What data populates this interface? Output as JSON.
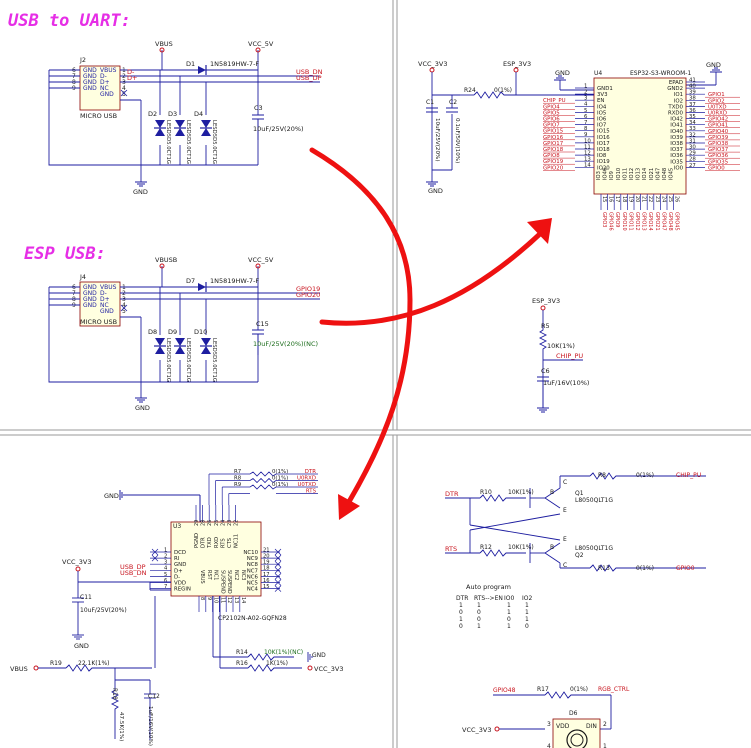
{
  "titles": {
    "usb_uart": "USB to UART:",
    "esp_usb": "ESP USB:"
  },
  "colors": {
    "title": "#e62ee6",
    "wire": "#1e1ea0",
    "net": "#c8141e",
    "part": "#1a1a1a",
    "nc": "#1e6e1e",
    "arrow": "#ee1111",
    "border": "#9a9a9a"
  },
  "usb_uart": {
    "conn_ref": "J2",
    "conn_name": "MICRO USB",
    "pins": [
      {
        "n": "6",
        "name": "GND"
      },
      {
        "n": "7",
        "name": "GND"
      },
      {
        "n": "8",
        "name": "GND"
      },
      {
        "n": "9",
        "name": "GND"
      }
    ],
    "pins_right": [
      {
        "n": "1",
        "name": "VBUS"
      },
      {
        "n": "2",
        "name": "D-"
      },
      {
        "n": "3",
        "name": "D+"
      },
      {
        "n": "4",
        "name": "NC"
      },
      {
        "n": "5",
        "name": "GND"
      }
    ],
    "vbus": "VBUS",
    "vcc": "VCC_5V",
    "diode_ref": "D1",
    "diode_val": "1N5819HW-7-F",
    "nets": [
      "USB_DN",
      "USB_DP"
    ],
    "tvs": [
      {
        "ref": "D2",
        "val": "LESD5D5.0CT1G"
      },
      {
        "ref": "D3",
        "val": "LESD5D5.0CT1G"
      },
      {
        "ref": "D4",
        "val": "LESD5D5.0CT1G"
      }
    ],
    "cap_ref": "C3",
    "cap_val": "10uF/25V(20%)",
    "gnd": "GND",
    "dminus": "D-",
    "dplus": "D+"
  },
  "esp_usb": {
    "conn_ref": "J4",
    "conn_name": "MICRO USB",
    "vbus": "VBUSB",
    "vcc": "VCC_5V",
    "diode_ref": "D7",
    "diode_val": "1N5819HW-7-F",
    "nets": [
      "GPIO19",
      "GPIO20"
    ],
    "tvs": [
      {
        "ref": "D8",
        "val": "LESD5D5.0CT1G"
      },
      {
        "ref": "D9",
        "val": "LESD5D5.0CT1G"
      },
      {
        "ref": "D10",
        "val": "LESD5D5.0CT1G"
      }
    ],
    "cap_ref": "C15",
    "cap_val": "10uF/25V(20%)(NC)",
    "gnd": "GND"
  },
  "esp": {
    "vcc": "VCC_3V3",
    "esp3v3": "ESP_3V3",
    "gnd": "GND",
    "gnd2": "GND",
    "r_ref": "R24",
    "r_val": "0(1%)",
    "c1": {
      "ref": "C1",
      "val": "10uF/25V(20%)"
    },
    "c2": {
      "ref": "C2",
      "val": "0.1uF/50V(10%)"
    },
    "module_ref": "U4",
    "module_name": "ESP32-S3-WROOM-1",
    "left_pins": [
      {
        "n": "1",
        "name": "GND1",
        "net": ""
      },
      {
        "n": "2",
        "name": "3V3",
        "net": ""
      },
      {
        "n": "3",
        "name": "EN",
        "net": "CHIP_PU"
      },
      {
        "n": "4",
        "name": "IO4",
        "net": "GPIO4"
      },
      {
        "n": "5",
        "name": "IO5",
        "net": "GPIO5"
      },
      {
        "n": "6",
        "name": "IO6",
        "net": "GPIO6"
      },
      {
        "n": "7",
        "name": "IO7",
        "net": "GPIO7"
      },
      {
        "n": "8",
        "name": "IO15",
        "net": "GPIO15"
      },
      {
        "n": "9",
        "name": "IO16",
        "net": "GPIO16"
      },
      {
        "n": "10",
        "name": "IO17",
        "net": "GPIO17"
      },
      {
        "n": "11",
        "name": "IO18",
        "net": "GPIO18"
      },
      {
        "n": "12",
        "name": "IO8",
        "net": "GPIO8"
      },
      {
        "n": "13",
        "name": "IO19",
        "net": "GPIO19"
      },
      {
        "n": "14",
        "name": "IO20",
        "net": "GPIO20"
      }
    ],
    "right_pins": [
      {
        "n": "41",
        "name": "EPAD",
        "net": ""
      },
      {
        "n": "40",
        "name": "GND2",
        "net": ""
      },
      {
        "n": "39",
        "name": "IO1",
        "net": "GPIO1"
      },
      {
        "n": "38",
        "name": "IO2",
        "net": "GPIO2"
      },
      {
        "n": "37",
        "name": "TXD0",
        "net": "U0TXD"
      },
      {
        "n": "36",
        "name": "RXD0",
        "net": "U0RXD"
      },
      {
        "n": "35",
        "name": "IO42",
        "net": "GPIO42"
      },
      {
        "n": "34",
        "name": "IO41",
        "net": "GPIO41"
      },
      {
        "n": "33",
        "name": "IO40",
        "net": "GPIO40"
      },
      {
        "n": "32",
        "name": "IO39",
        "net": "GPIO39"
      },
      {
        "n": "31",
        "name": "IO38",
        "net": "GPIO38"
      },
      {
        "n": "30",
        "name": "IO37",
        "net": "GPIO37"
      },
      {
        "n": "29",
        "name": "IO36",
        "net": "GPIO36"
      },
      {
        "n": "28",
        "name": "IO35",
        "net": "GPIO35"
      },
      {
        "n": "27",
        "name": "IO0",
        "net": "GPIO0"
      }
    ],
    "bottom_pins": [
      {
        "n": "15",
        "name": "IO3",
        "net": "GPIO3"
      },
      {
        "n": "16",
        "name": "IO46",
        "net": "GPIO46"
      },
      {
        "n": "17",
        "name": "IO9",
        "net": "GPIO9"
      },
      {
        "n": "18",
        "name": "IO10",
        "net": "GPIO10"
      },
      {
        "n": "19",
        "name": "IO11",
        "net": "GPIO11"
      },
      {
        "n": "20",
        "name": "IO12",
        "net": "GPIO12"
      },
      {
        "n": "21",
        "name": "IO13",
        "net": "GPIO13"
      },
      {
        "n": "22",
        "name": "IO14",
        "net": "GPIO14"
      },
      {
        "n": "23",
        "name": "IO21",
        "net": "GPIO21"
      },
      {
        "n": "24",
        "name": "IO47",
        "net": "GPIO47"
      },
      {
        "n": "25",
        "name": "IO48",
        "net": "GPIO48"
      },
      {
        "n": "26",
        "name": "IO45",
        "net": "GPIO45"
      }
    ]
  },
  "en_rc": {
    "vcc": "ESP_3V3",
    "r_ref": "R5",
    "r_val": "10K(1%)",
    "net": "CHIP_PU",
    "c_ref": "C6",
    "c_val": "1uF/16V(10%)"
  },
  "cp2102": {
    "gnd_label": "GND",
    "ref": "U3",
    "name": "CP2102N-A02-GQFN28",
    "resistors": [
      {
        "ref": "R7",
        "val": "0(1%)",
        "net": "DTR"
      },
      {
        "ref": "R8",
        "val": "0(1%)",
        "net": "U0RXD"
      },
      {
        "ref": "R9",
        "val": "0(1%)",
        "net": "U0TXD"
      },
      {
        "ref": "",
        "val": "",
        "net": "RTS"
      }
    ],
    "top_pins": [
      {
        "n": "29",
        "name": "PGND"
      },
      {
        "n": "28",
        "name": "DTR"
      },
      {
        "n": "26",
        "name": "TXD"
      },
      {
        "n": "25",
        "name": "RXD"
      },
      {
        "n": "24",
        "name": "RTS"
      },
      {
        "n": "23",
        "name": "CTS"
      },
      {
        "n": "22",
        "name": "NC11"
      }
    ],
    "left_pins": [
      {
        "n": "1",
        "name": "DCD"
      },
      {
        "n": "2",
        "name": "RI"
      },
      {
        "n": "3",
        "name": "GND"
      },
      {
        "n": "4",
        "name": "D+"
      },
      {
        "n": "5",
        "name": "D-"
      },
      {
        "n": "6",
        "name": "VDD"
      },
      {
        "n": "7",
        "name": "REGIN"
      }
    ],
    "left_nets": [
      "USB_DP",
      "USB_DN"
    ],
    "right_pins": [
      {
        "n": "21",
        "name": "NC10"
      },
      {
        "n": "20",
        "name": "NC9"
      },
      {
        "n": "19",
        "name": "NC8"
      },
      {
        "n": "18",
        "name": "NC7"
      },
      {
        "n": "17",
        "name": "NC6"
      },
      {
        "n": "16",
        "name": "NC5"
      },
      {
        "n": "15",
        "name": "NC4"
      }
    ],
    "bottom_pins": [
      {
        "n": "8",
        "name": "VBUS"
      },
      {
        "n": "9",
        "name": "RST"
      },
      {
        "n": "10",
        "name": "NC1"
      },
      {
        "n": "11",
        "name": "SUSPEND"
      },
      {
        "n": "12",
        "name": "SUSPEND"
      },
      {
        "n": "13",
        "name": "NC2"
      },
      {
        "n": "14",
        "name": "NC3"
      }
    ],
    "r14": {
      "ref": "R14",
      "val": "10K(1%)(NC)",
      "gnd": "GND"
    },
    "r16": {
      "ref": "R16",
      "val": "1K(1%)",
      "net": "VCC_3V3"
    },
    "vcc": "VCC_3V3",
    "c11": {
      "ref": "C11",
      "val": "10uF/25V(20%)"
    },
    "gnd": "GND",
    "vbus": "VBUS",
    "r19": {
      "ref": "R19",
      "val": "22.1K(1%)"
    },
    "r18": {
      "ref": "R18",
      "val": "47.5K(1%)"
    },
    "c12": {
      "ref": "C12",
      "val": "1uF/16V(10%)"
    }
  },
  "autoprog": {
    "dtr": "DTR",
    "rts": "RTS",
    "r10": {
      "ref": "R10",
      "val": "10K(1%)"
    },
    "r12": {
      "ref": "R12",
      "val": "10K(1%)"
    },
    "q1": {
      "ref": "Q1",
      "val": "L8050QLT1G"
    },
    "q2": {
      "ref": "Q2",
      "val": "L8050QLT1G"
    },
    "r8": {
      "ref": "R8",
      "val": "0(1%)",
      "net": "CHIP_PU"
    },
    "r13": {
      "ref": "R13",
      "val": "0(1%)",
      "net": "GPIO0"
    },
    "b": "B",
    "c": "C",
    "e": "E",
    "table_title": "Auto program",
    "table": [
      [
        "DTR",
        "RTS-->EN",
        "IO0",
        "IO2"
      ],
      [
        "1",
        "1",
        "1",
        "1"
      ],
      [
        "0",
        "0",
        "1",
        "1"
      ],
      [
        "1",
        "0",
        "0",
        "1"
      ],
      [
        "0",
        "1",
        "1",
        "0"
      ]
    ]
  },
  "rgb": {
    "net_in": "GPIO48",
    "r_ref": "R17",
    "r_val": "0(1%)",
    "net": "RGB_CTRL",
    "vcc": "VCC_3V3",
    "ref": "D6",
    "vdd": "VDD",
    "din": "DIN",
    "p3": "3",
    "p2": "2",
    "p4": "4",
    "p1": "1"
  }
}
